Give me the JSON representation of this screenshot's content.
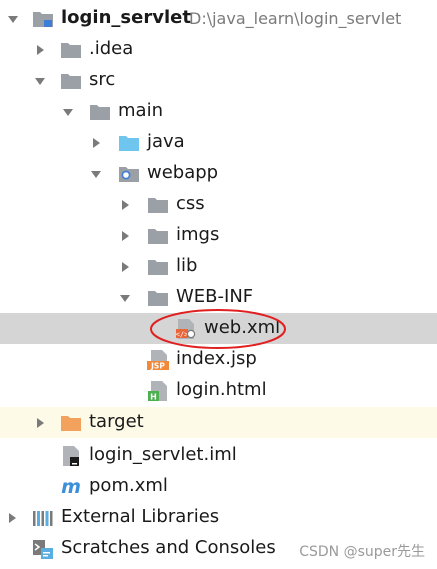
{
  "tree": {
    "root": {
      "name": "login_servlet",
      "path": "D:\\java_learn\\login_servlet"
    },
    "idea": {
      "name": ".idea"
    },
    "src": {
      "name": "src"
    },
    "main": {
      "name": "main"
    },
    "java": {
      "name": "java"
    },
    "webapp": {
      "name": "webapp"
    },
    "css": {
      "name": "css"
    },
    "imgs": {
      "name": "imgs"
    },
    "lib": {
      "name": "lib"
    },
    "webinf": {
      "name": "WEB-INF"
    },
    "webxml": {
      "name": "web.xml",
      "icon_badge": "</>"
    },
    "indexjsp": {
      "name": "index.jsp",
      "icon_badge": "JSP"
    },
    "loginhtml": {
      "name": "login.html",
      "icon_badge": "H"
    },
    "target": {
      "name": "target"
    },
    "iml": {
      "name": "login_servlet.iml"
    },
    "pom": {
      "name": "pom.xml",
      "icon_badge": "m"
    },
    "external": {
      "name": "External Libraries"
    },
    "scratches": {
      "name": "Scratches and Consoles"
    }
  },
  "watermark": "CSDN @super先生",
  "colors": {
    "selected_row": "#d5d5d5",
    "target_row": "#fdfae8",
    "folder_gray": "#9aa0a6",
    "folder_blue": "#6ec6ef",
    "folder_orange": "#f2a25c",
    "annotation_red": "#e02020",
    "jsp_badge": "#f08a3a",
    "html_badge": "#4caf50",
    "maven_blue": "#3d8fd8"
  }
}
